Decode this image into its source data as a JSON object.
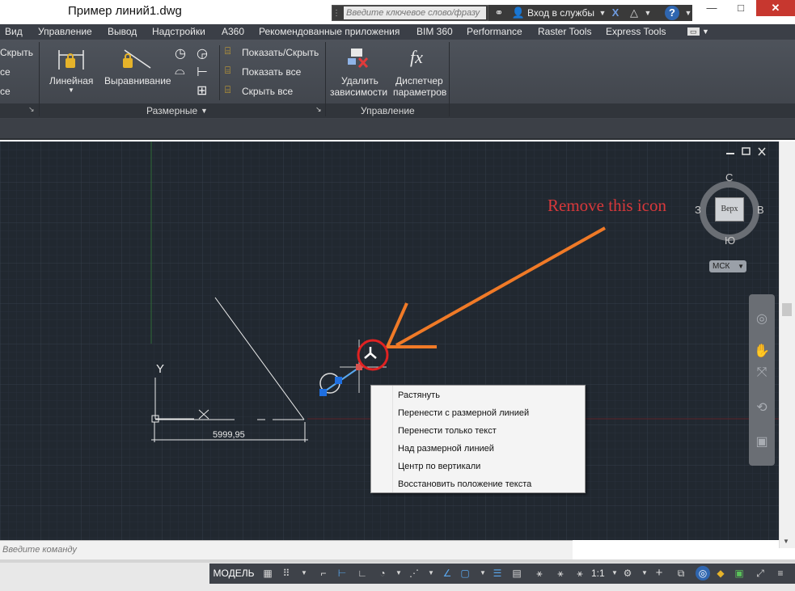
{
  "window": {
    "title": "Пример линий1.dwg",
    "search_placeholder": "Введите ключевое слово/фразу",
    "signin_label": "Вход в службы",
    "minimize": "—",
    "maximize": "□",
    "close": "✕"
  },
  "menu": {
    "items": [
      "Вид",
      "Управление",
      "Вывод",
      "Надстройки",
      "A360",
      "Рекомендованные приложения",
      "BIM 360",
      "Performance",
      "Raster Tools",
      "Express Tools"
    ]
  },
  "ribbon": {
    "left_panel": {
      "row1": "Скрыть",
      "row2": "се",
      "row3": "се"
    },
    "linear_label": "Линейная",
    "align_label": "Выравнивание",
    "show_hide_label": "Показать/Скрыть",
    "show_all_label": "Показать все",
    "hide_all_label": "Скрыть все",
    "delete_constraints_line1": "Удалить",
    "delete_constraints_line2": "зависимости",
    "params_manager_line1": "Диспетчер",
    "params_manager_line2": "параметров",
    "panel_dimensional": "Размерные",
    "panel_manage": "Управление",
    "fx_glyph": "fx"
  },
  "drawing": {
    "dimension_value": "5999,95",
    "y_axis_label": "Y",
    "annotation": "Remove this icon",
    "annotation_color": "#d8383b",
    "arrow_color": "#f07a27",
    "canvas_color": "#212830"
  },
  "viewcube": {
    "face": "Верх",
    "north": "С",
    "south": "Ю",
    "west": "З",
    "east": "В",
    "wcs_label": "МСК"
  },
  "context_menu": {
    "items": [
      "Растянуть",
      "Перенести с размерной линией",
      "Перенести только текст",
      "Над размерной линией",
      "Центр по вертикали",
      "Восстановить положение текста"
    ]
  },
  "command_line": {
    "placeholder": "Введите команду"
  },
  "statusbar": {
    "model_tab": "МОДЕЛЬ",
    "scale": "1:1"
  }
}
